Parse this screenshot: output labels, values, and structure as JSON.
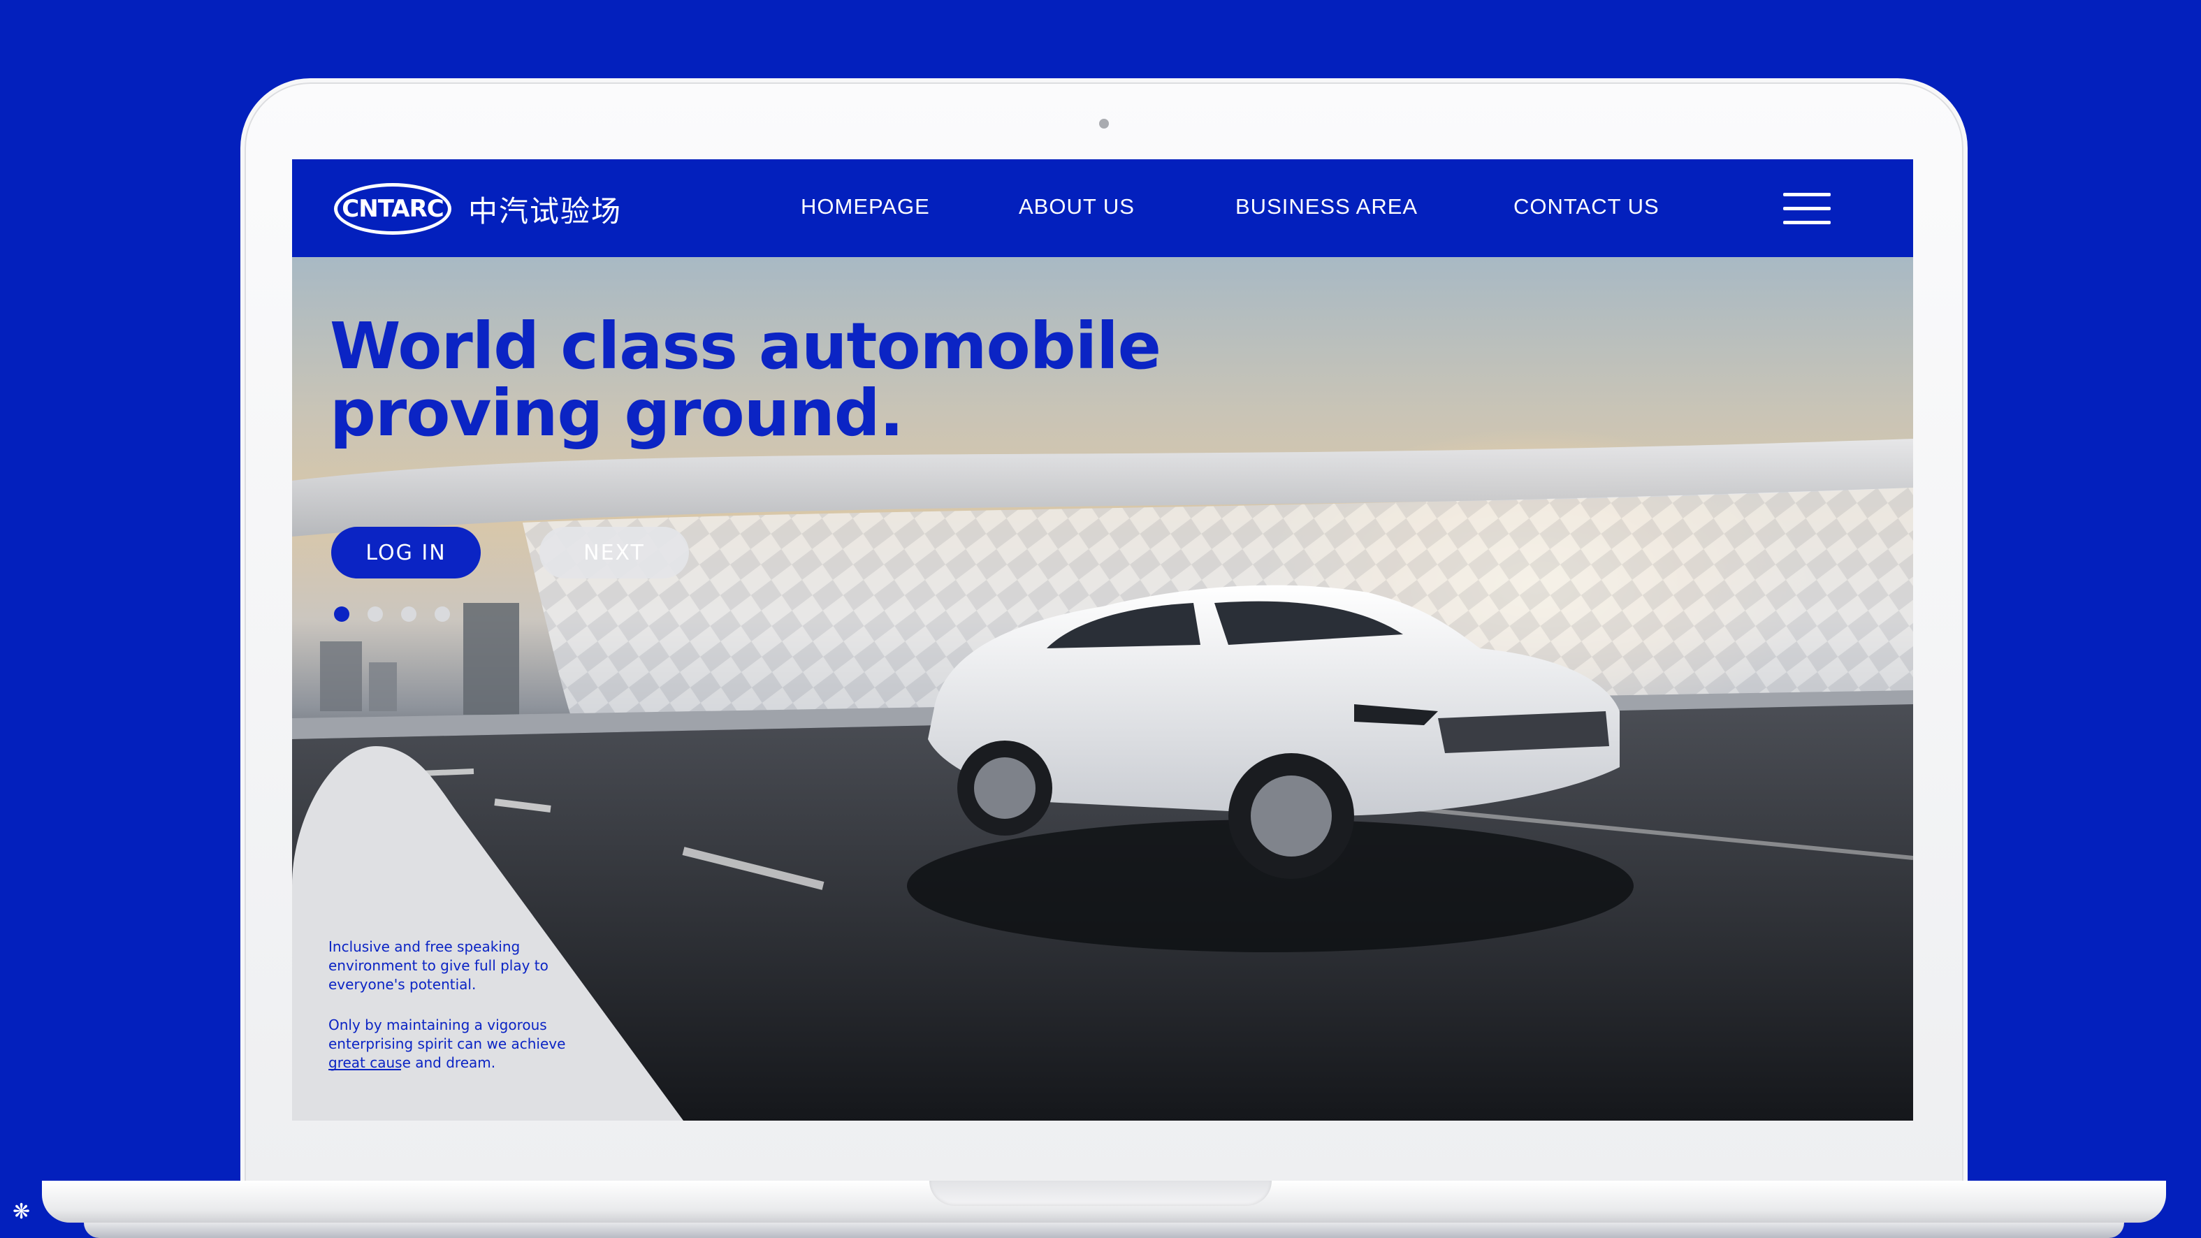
{
  "brand": {
    "logo_text": "CNTARC",
    "name_cn": "中汽试验场"
  },
  "nav": {
    "items": [
      {
        "label": "HOMEPAGE"
      },
      {
        "label": "ABOUT US"
      },
      {
        "label": "BUSINESS AREA"
      },
      {
        "label": "CONTACT US"
      }
    ]
  },
  "hero": {
    "headline_line1": "World class automobile",
    "headline_line2": "proving ground.",
    "login_label": "LOG IN",
    "next_label": "NEXT",
    "slides_total": 4,
    "slide_active": 1
  },
  "info": {
    "paragraph1": "Inclusive and free speaking environment to give full play to everyone's potential.",
    "paragraph2": "Only by maintaining a vigorous enterprising spirit can we achieve great cause and dream."
  },
  "colors": {
    "background": "#0320bd",
    "brand_blue": "#0b24c4",
    "button_secondary": "#e4e5e8"
  }
}
